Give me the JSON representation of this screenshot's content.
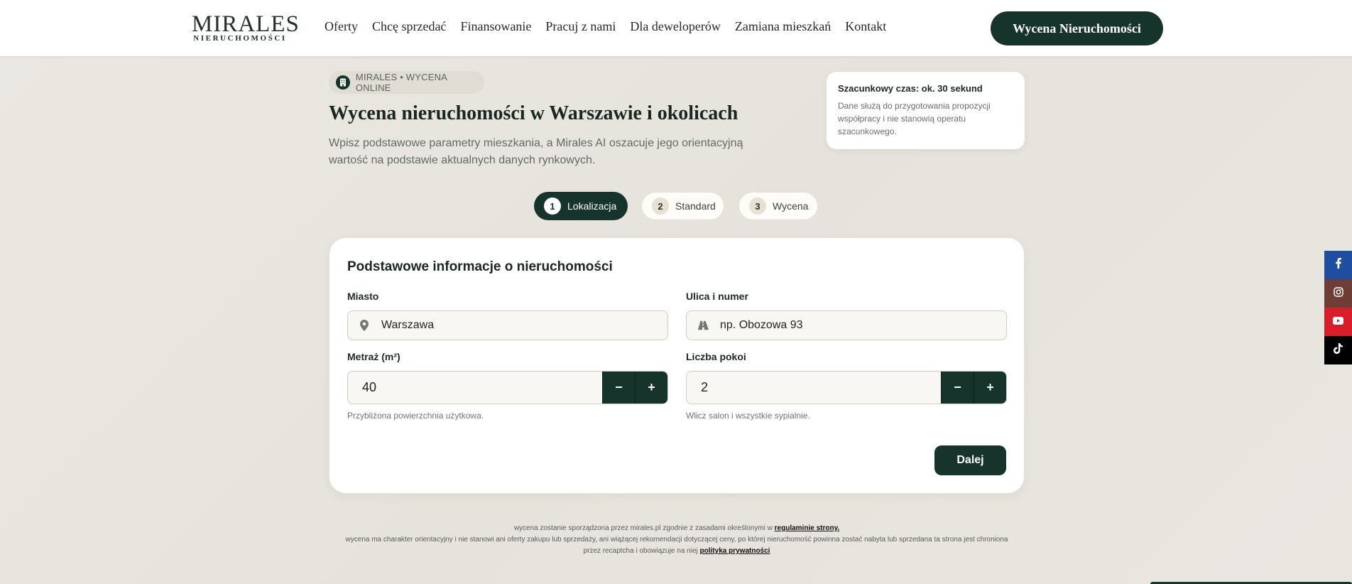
{
  "header": {
    "logo_main": "MIRALES",
    "logo_sub": "NIERUCHOMOŚCI",
    "nav": [
      "Oferty",
      "Chcę sprzedać",
      "Finansowanie",
      "Pracuj z nami",
      "Dla deweloperów",
      "Zamiana mieszkań",
      "Kontakt"
    ],
    "cta": "Wycena Nieruchomości"
  },
  "hero": {
    "badge": "MIRALES • WYCENA ONLINE",
    "title": "Wycena nieruchomości w Warszawie i okolicach",
    "subtitle": "Wpisz podstawowe parametry mieszkania, a Mirales AI oszacuje jego orientacyjną wartość na podstawie aktualnych danych rynkowych."
  },
  "info": {
    "title": "Szacunkowy czas: ok. 30 sekund",
    "text": "Dane służą do przygotowania propozycji współpracy i nie stanowią operatu szacunkowego."
  },
  "steps": [
    {
      "num": "1",
      "label": "Lokalizacja"
    },
    {
      "num": "2",
      "label": "Standard"
    },
    {
      "num": "3",
      "label": "Wycena"
    }
  ],
  "form": {
    "title": "Podstawowe informacje o nieruchomości",
    "city_label": "Miasto",
    "city_value": "Warszawa",
    "street_label": "Ulica i numer",
    "street_placeholder": "np. Obozowa 93",
    "area_label": "Metraż (m²)",
    "area_value": "40",
    "area_hint": "Przybliżona powierzchnia użytkowa.",
    "rooms_label": "Liczba pokoi",
    "rooms_value": "2",
    "rooms_hint": "Wlicz salon i wszystkie sypialnie.",
    "minus": "−",
    "plus": "+",
    "next": "Dalej"
  },
  "footer": {
    "line1": "wycena zostanie sporządzona przez mirales.pl zgodnie z zasadami określonymi w",
    "link1": "regulaminie strony.",
    "line2": "wycena ma charakter orientacyjny i nie stanowi ani oferty zakupu lub sprzedaży, ani wiążącej rekomendacji dotyczącej ceny, po której nieruchomość powinna zostać nabyta lub sprzedana ta strona jest chroniona przez recaptcha i obowiązuje na niej",
    "link2": "polityka prywatności"
  },
  "colors": {
    "brand": "#16342b",
    "facebook": "#1f4ea0",
    "instagram": "#6e3e36",
    "youtube": "#d81e2b",
    "tiktok": "#000000"
  }
}
